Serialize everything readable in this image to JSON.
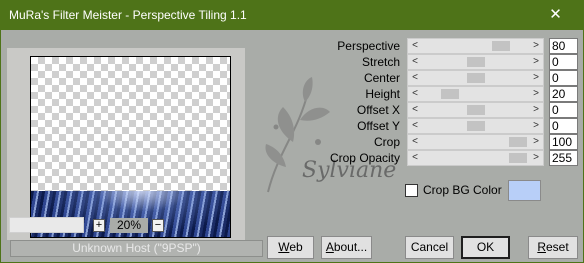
{
  "window": {
    "title": "MuRa's Filter Meister - Perspective Tiling 1.1",
    "close_glyph": "✕",
    "accent_color": "#4e7318"
  },
  "params": [
    {
      "label": "Perspective",
      "value": "80",
      "level": 0.8
    },
    {
      "label": "Stretch",
      "value": "0",
      "level": 0.5
    },
    {
      "label": "Center",
      "value": "0",
      "level": 0.5
    },
    {
      "label": "Height",
      "value": "20",
      "level": 0.2
    },
    {
      "label": "Offset X",
      "value": "0",
      "level": 0.5
    },
    {
      "label": "Offset Y",
      "value": "0",
      "level": 0.5
    },
    {
      "label": "Crop",
      "value": "100",
      "level": 1.0
    },
    {
      "label": "Crop Opacity",
      "value": "255",
      "level": 1.0
    }
  ],
  "crop_bg": {
    "label": "Crop BG Color",
    "checked": false,
    "color": "#b8cff8"
  },
  "zoom": {
    "plus": "+",
    "value": "20%",
    "minus": "−"
  },
  "host": {
    "text": "Unknown Host (\"9PSP\")"
  },
  "buttons": {
    "web": {
      "lead": "W",
      "rest": "eb"
    },
    "about": {
      "lead": "A",
      "rest": "bout..."
    },
    "cancel": {
      "label": "Cancel"
    },
    "ok": {
      "label": "OK"
    },
    "reset": {
      "lead": "R",
      "rest": "eset"
    }
  },
  "watermark": {
    "text": "Sylviane"
  }
}
